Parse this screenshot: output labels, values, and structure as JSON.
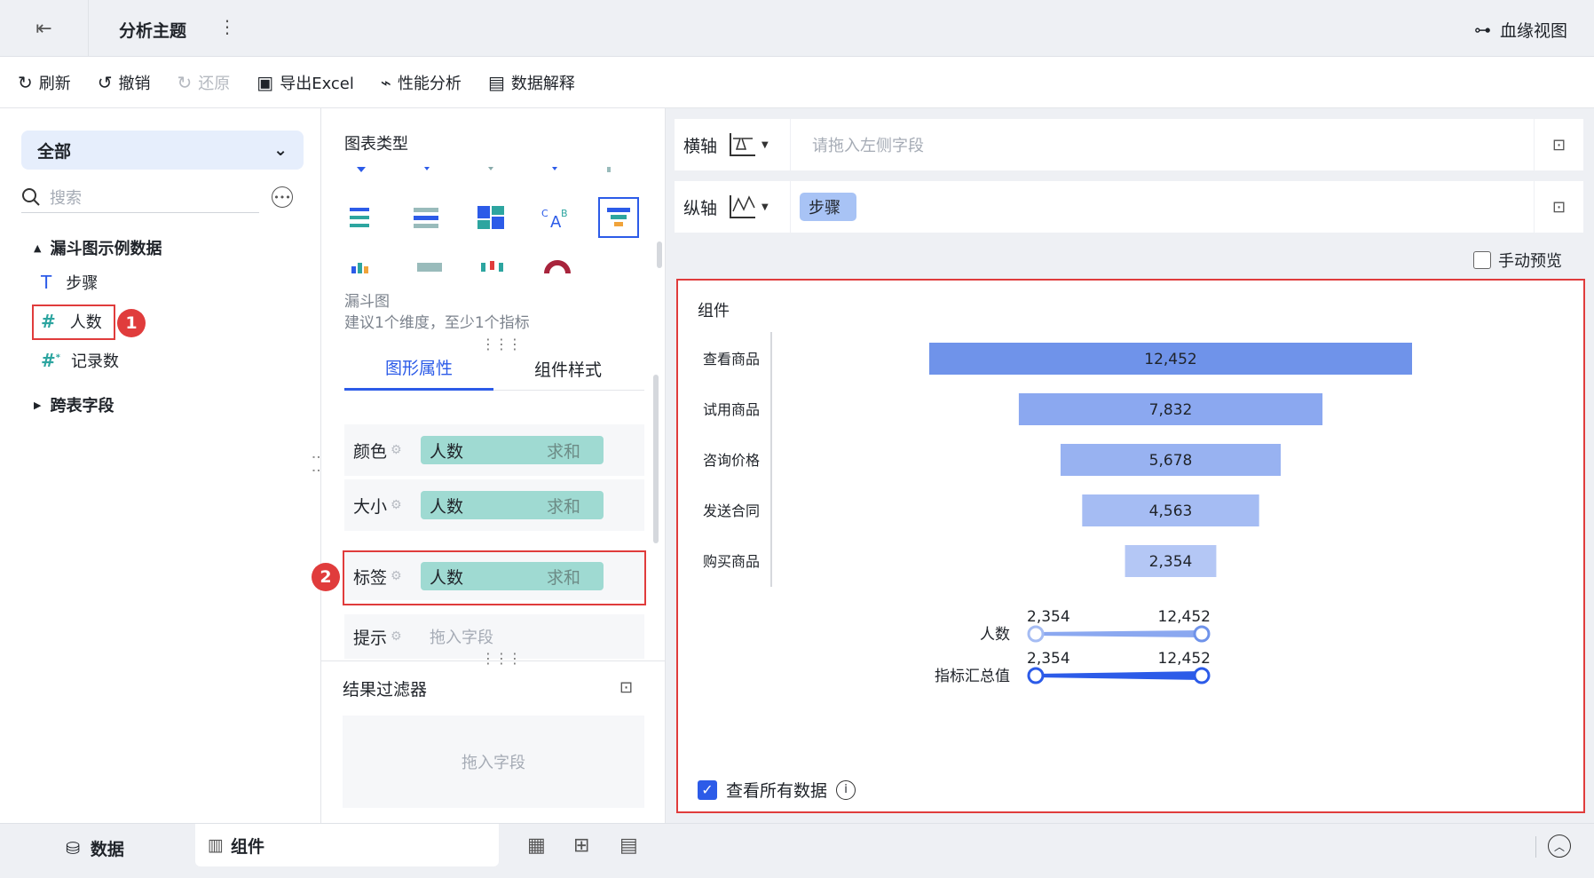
{
  "header": {
    "title": "分析主题",
    "lineage_label": "血缘视图"
  },
  "toolbar": {
    "refresh": "刷新",
    "undo": "撤销",
    "redo": "还原",
    "export": "导出Excel",
    "perf": "性能分析",
    "explain": "数据解释"
  },
  "left": {
    "scope": "全部",
    "search_placeholder": "搜索",
    "dataset": "漏斗图示例数据",
    "fields": [
      {
        "name": "步骤",
        "type": "text"
      },
      {
        "name": "人数",
        "type": "number"
      },
      {
        "name": "记录数",
        "type": "number-calc"
      }
    ],
    "cross_table": "跨表字段",
    "badge1": "1"
  },
  "middle": {
    "chart_type_label": "图表类型",
    "chart_name": "漏斗图",
    "chart_hint": "建议1个维度，至少1个指标",
    "tab_graph": "图形属性",
    "tab_style": "组件样式",
    "props": [
      {
        "label": "颜色",
        "field": "人数",
        "agg": "求和"
      },
      {
        "label": "大小",
        "field": "人数",
        "agg": "求和"
      },
      {
        "label": "标签",
        "field": "人数",
        "agg": "求和"
      },
      {
        "label": "提示",
        "placeholder": "拖入字段"
      }
    ],
    "badge2": "2",
    "filter_title": "结果过滤器",
    "filter_placeholder": "拖入字段"
  },
  "right": {
    "x_axis_label": "横轴",
    "x_axis_placeholder": "请拖入左侧字段",
    "y_axis_label": "纵轴",
    "y_axis_field": "步骤",
    "manual_preview": "手动预览",
    "widget_title": "组件",
    "view_all": "查看所有数据"
  },
  "chart_data": {
    "type": "bar",
    "subtype": "funnel",
    "categories": [
      "查看商品",
      "试用商品",
      "咨询价格",
      "发送合同",
      "购买商品"
    ],
    "values": [
      12452,
      7832,
      5678,
      4563,
      2354
    ],
    "labels": [
      "12,452",
      "7,832",
      "5,678",
      "4,563",
      "2,354"
    ],
    "colors": [
      "#6f93ea",
      "#8ba8f0",
      "#98b2f1",
      "#a5bcf3",
      "#b4c7f5"
    ],
    "legends": [
      {
        "name": "人数",
        "min_label": "2,354",
        "max_label": "12,452"
      },
      {
        "name": "指标汇总值",
        "min_label": "2,354",
        "max_label": "12,452"
      }
    ],
    "min": 2354,
    "max": 12452
  },
  "bottom": {
    "data_tab": "数据",
    "widget_tab": "组件"
  }
}
